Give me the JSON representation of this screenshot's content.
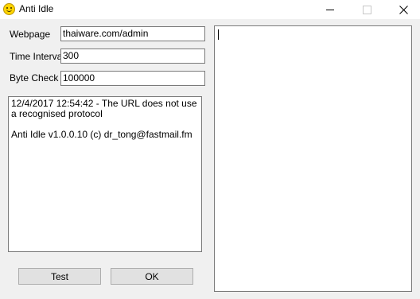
{
  "window": {
    "title": "Anti Idle",
    "icon": "smiley-icon"
  },
  "form": {
    "webpage_label": "Webpage",
    "webpage_value": "thaiware.com/admin",
    "interval_label": "Time Interval",
    "interval_value": "300",
    "bytecheck_label": "Byte Check",
    "bytecheck_value": "100000"
  },
  "log": {
    "line1": "12/4/2017 12:54:42 - The URL does not use a recognised protocol",
    "line2": "Anti Idle v1.0.0.10 (c) dr_tong@fastmail.fm"
  },
  "buttons": {
    "test_label": "Test",
    "ok_label": "OK"
  },
  "right_panel": {
    "content": ""
  }
}
